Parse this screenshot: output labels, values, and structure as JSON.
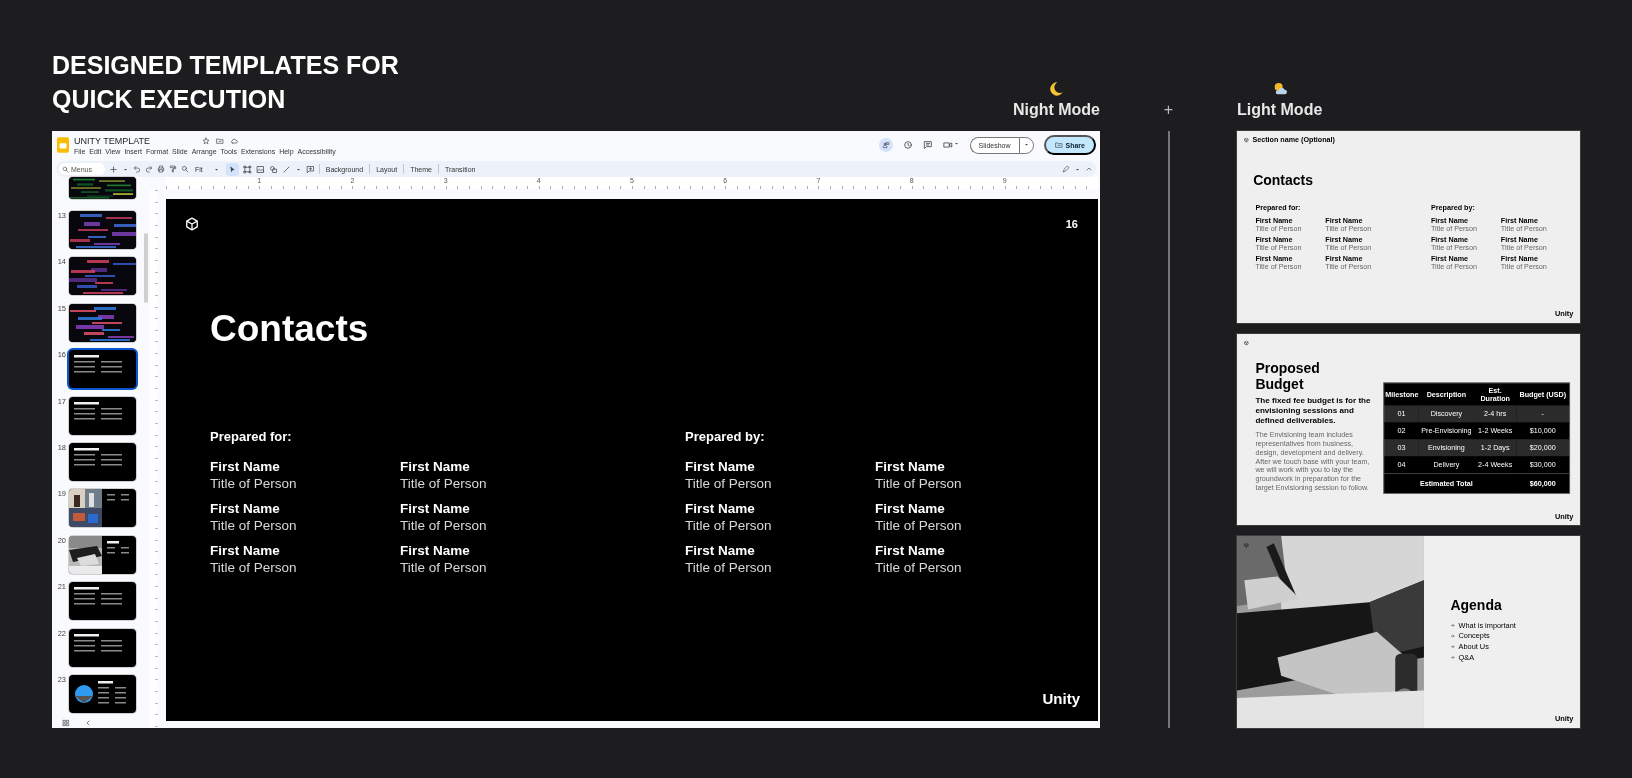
{
  "heading": "DESIGNED TEMPLATES FOR QUICK EXECUTION",
  "night_label": "Night Mode",
  "separator": "+",
  "light_label": "Light Mode",
  "editor": {
    "title": "UNITY TEMPLATE",
    "menu": [
      "File",
      "Edit",
      "View",
      "Insert",
      "Format",
      "Slide",
      "Arrange",
      "Tools",
      "Extensions",
      "Help",
      "Accessibility"
    ],
    "search": {
      "placeholder": "Menus"
    },
    "zoom": "Fit",
    "tools": [
      "Background",
      "Layout",
      "Theme",
      "Transition"
    ],
    "slideshow": "Slideshow",
    "share": "Share",
    "ruler": [
      "1",
      "2",
      "3",
      "4",
      "5",
      "6",
      "7",
      "8",
      "9"
    ],
    "thumbnails": [
      {
        "kind": "divider",
        "selected": false
      },
      {
        "number": "13",
        "kind": "divider",
        "selected": false
      },
      {
        "number": "14",
        "kind": "divider",
        "selected": false
      },
      {
        "number": "15",
        "kind": "divider",
        "selected": false
      },
      {
        "number": "16",
        "kind": "text",
        "selected": true
      },
      {
        "number": "17",
        "kind": "text",
        "selected": false
      },
      {
        "number": "18",
        "kind": "text",
        "selected": false
      },
      {
        "number": "19",
        "selected": false
      },
      {
        "number": "20",
        "kind": "split",
        "selected": false
      },
      {
        "number": "21",
        "kind": "text",
        "selected": false
      },
      {
        "number": "22",
        "kind": "text",
        "selected": false
      },
      {
        "number": "23",
        "kind": "hero",
        "selected": false
      }
    ],
    "slide": {
      "number": "16",
      "title": "Contacts",
      "groups": [
        {
          "label": "Prepared for:",
          "people": [
            {
              "name": "First Name",
              "title": "Title of Person"
            },
            {
              "name": "First Name",
              "title": "Title of Person"
            },
            {
              "name": "First Name",
              "title": "Title of Person"
            },
            {
              "name": "First Name",
              "title": "Title of Person"
            },
            {
              "name": "First Name",
              "title": "Title of Person"
            },
            {
              "name": "First Name",
              "title": "Title of Person"
            }
          ]
        },
        {
          "label": "Prepared by:",
          "people": [
            {
              "name": "First Name",
              "title": "Title of Person"
            },
            {
              "name": "First Name",
              "title": "Title of Person"
            },
            {
              "name": "First Name",
              "title": "Title of Person"
            },
            {
              "name": "First Name",
              "title": "Title of Person"
            },
            {
              "name": "First Name",
              "title": "Title of Person"
            },
            {
              "name": "First Name",
              "title": "Title of Person"
            }
          ]
        }
      ],
      "brand": "Unity"
    }
  },
  "light_slides": [
    {
      "kind": "contacts",
      "section": "Section name (Optional)",
      "title": "Contacts",
      "groups": [
        {
          "label": "Prepared for:",
          "people": [
            {
              "name": "First Name",
              "title": "Title of Person"
            },
            {
              "name": "First Name",
              "title": "Title of Person"
            },
            {
              "name": "First Name",
              "title": "Title of Person"
            },
            {
              "name": "First Name",
              "title": "Title of Person"
            },
            {
              "name": "First Name",
              "title": "Title of Person"
            },
            {
              "name": "First Name",
              "title": "Title of Person"
            }
          ]
        },
        {
          "label": "Prepared by:",
          "people": [
            {
              "name": "First Name",
              "title": "Title of Person"
            },
            {
              "name": "First Name",
              "title": "Title of Person"
            },
            {
              "name": "First Name",
              "title": "Title of Person"
            },
            {
              "name": "First Name",
              "title": "Title of Person"
            },
            {
              "name": "First Name",
              "title": "Title of Person"
            },
            {
              "name": "First Name",
              "title": "Title of Person"
            }
          ]
        }
      ],
      "brand": "Unity"
    },
    {
      "kind": "budget",
      "title": "Proposed Budget",
      "subtitle": "The fixed fee budget is for the envisioning sessions and defined deliverables.",
      "body": "The Envisioning team includes representatives from business, design, development and delivery. After we touch base with your team, we will work with you to lay the groundwork in preparation for the target Envisioning session to follow.",
      "columns": [
        "Milestone",
        "Description",
        "Est. Duration",
        "Budget (USD)"
      ],
      "rows": [
        [
          "01",
          "Discovery",
          "2-4 hrs",
          "-"
        ],
        [
          "02",
          "Pre-Envisioning",
          "1-2 Weeks",
          "$10,000"
        ],
        [
          "03",
          "Envisioning",
          "1-2 Days",
          "$20,000"
        ],
        [
          "04",
          "Delivery",
          "2-4 Weeks",
          "$30,000"
        ]
      ],
      "total": {
        "label": "Estimated Total",
        "value": "$60,000"
      },
      "brand": "Unity"
    },
    {
      "kind": "agenda",
      "title": "Agenda",
      "items": [
        "What is important",
        "Concepts",
        "About Us",
        "Q&A"
      ],
      "brand": "Unity"
    }
  ]
}
